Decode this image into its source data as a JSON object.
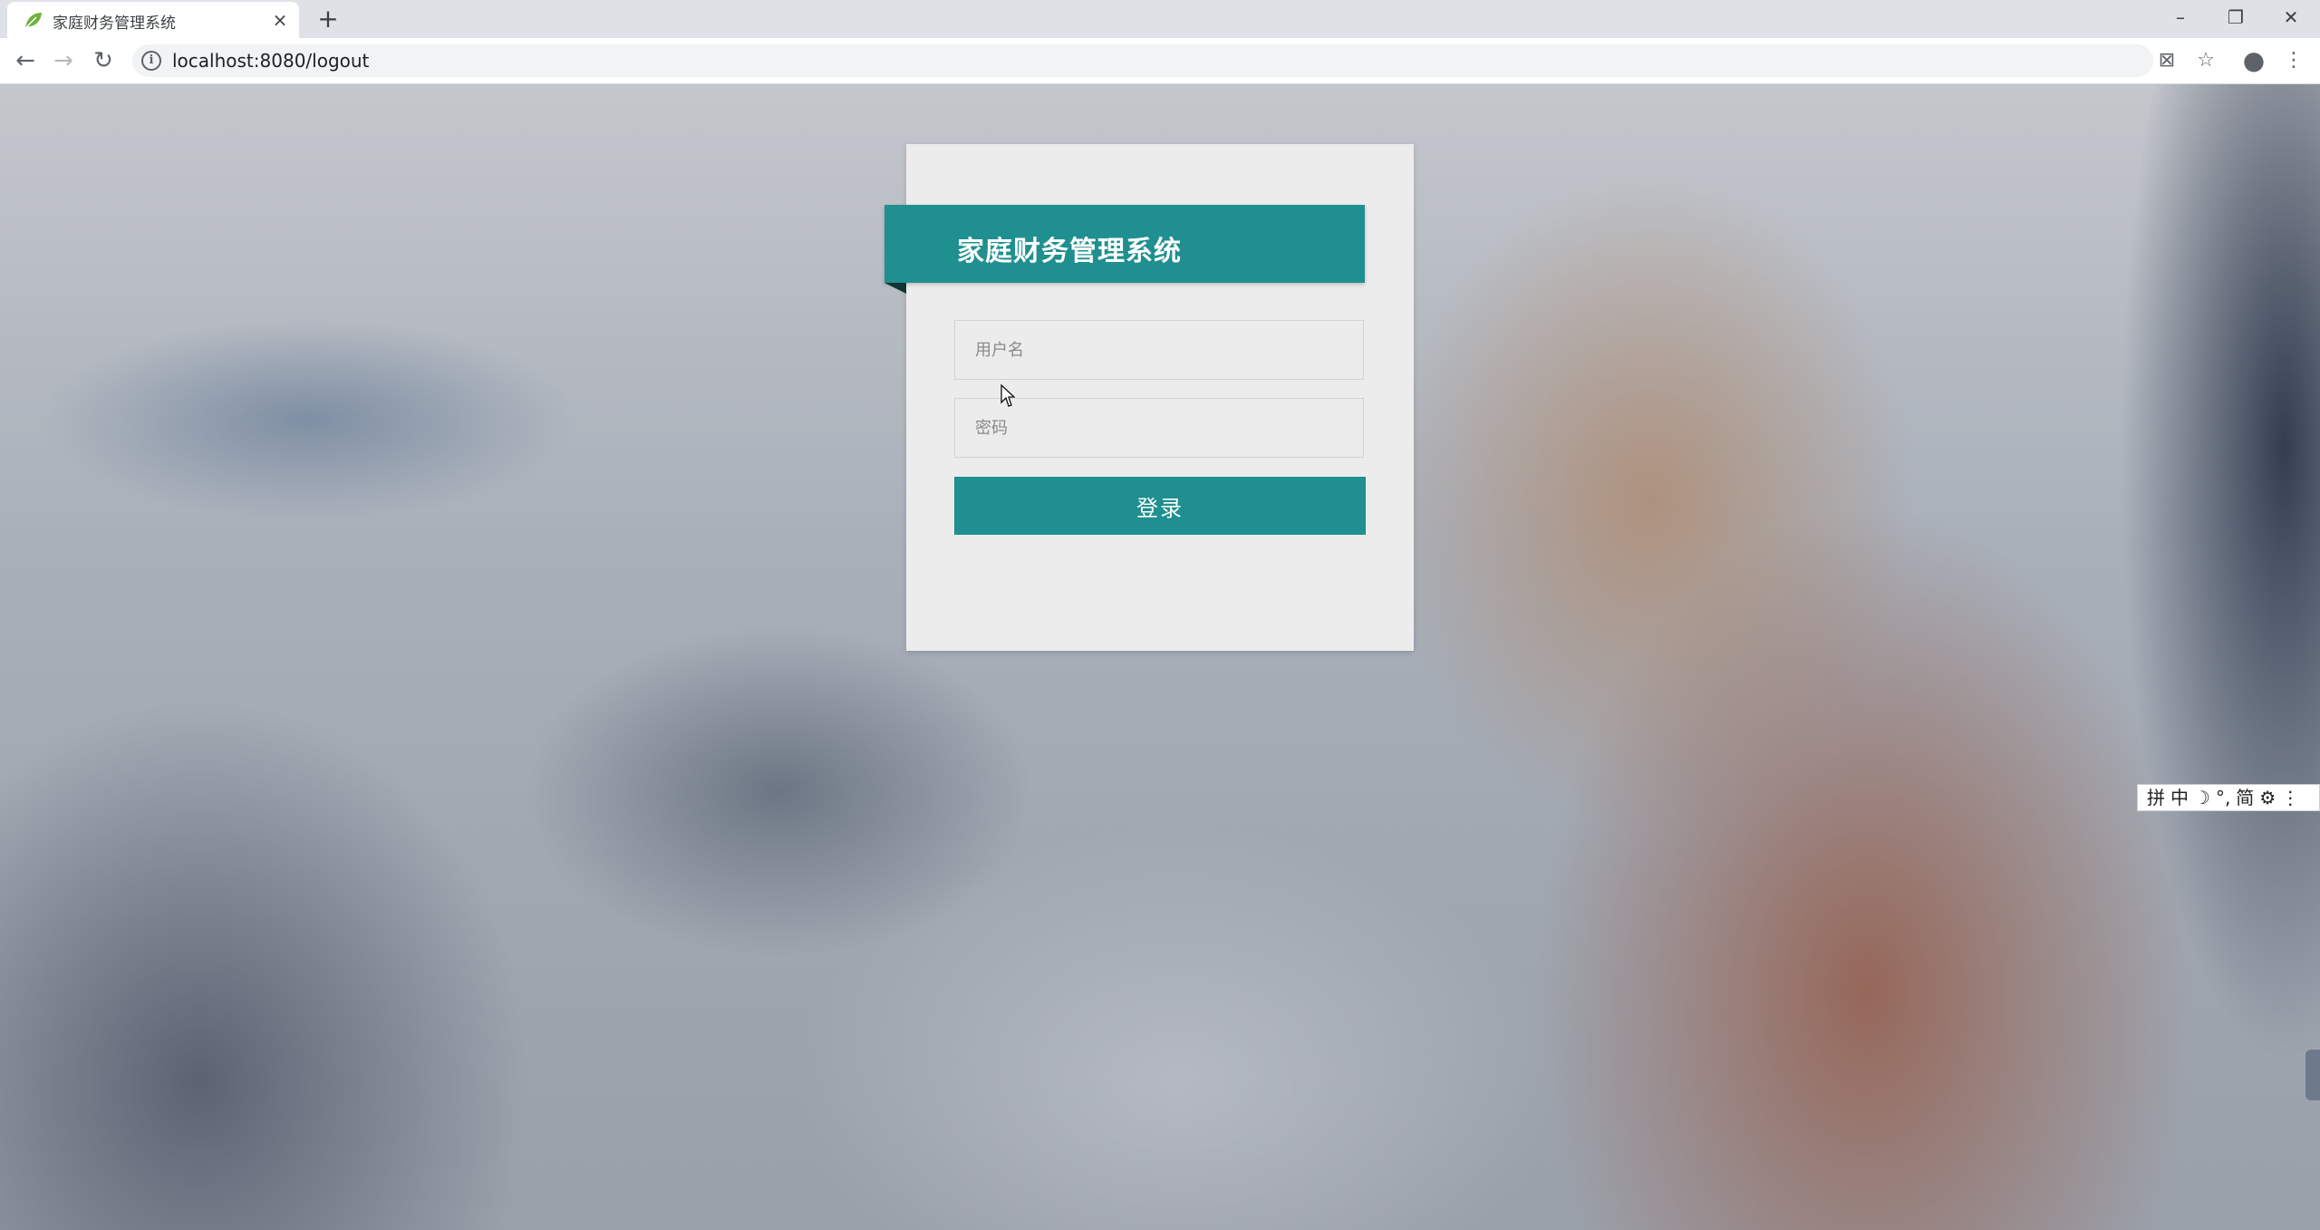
{
  "browser": {
    "tab_title": "家庭财务管理系统",
    "tab_close": "×",
    "new_tab": "+",
    "url": "localhost:8080/logout",
    "info_icon": "i",
    "window_controls": {
      "minimize": "–",
      "restore": "❐",
      "close": "✕"
    },
    "nav": {
      "back": "←",
      "forward": "→",
      "reload": "↻"
    },
    "toolbar_icons": {
      "translate": "⊠",
      "bookmark": "☆",
      "profile": "●",
      "menu": "⋮"
    }
  },
  "login": {
    "title": "家庭财务管理系统",
    "username_placeholder": "用户名",
    "password_placeholder": "密码",
    "submit_label": "登录"
  },
  "ime_bar": {
    "items": [
      "拼",
      "中",
      "☽",
      "°,",
      "简",
      "⚙",
      "⋮"
    ]
  },
  "colors": {
    "accent": "#1f8f8f",
    "card_bg": "#ececec"
  }
}
